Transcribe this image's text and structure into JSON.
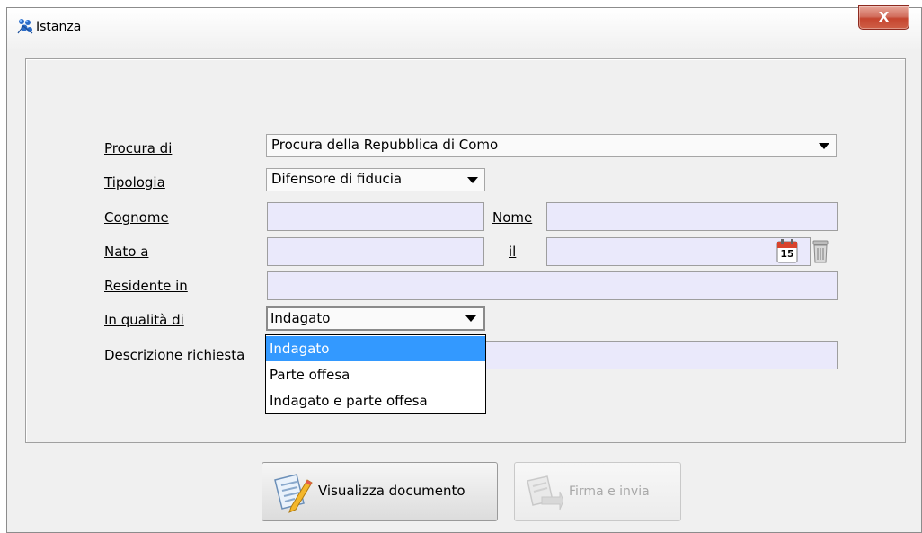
{
  "window": {
    "title": "Istanza",
    "close_symbol": "X"
  },
  "form": {
    "procura": {
      "label": "Procura di",
      "value": "Procura della Repubblica di Como"
    },
    "tipologia": {
      "label": "Tipologia",
      "value": "Difensore di fiducia"
    },
    "cognome": {
      "label": "Cognome",
      "value": ""
    },
    "nome": {
      "label": "Nome",
      "value": ""
    },
    "nato_a": {
      "label": "Nato a",
      "value": ""
    },
    "il": {
      "label": "il",
      "value": "",
      "calendar_day": "15"
    },
    "residente_in": {
      "label": "Residente in ",
      "value": ""
    },
    "in_qualita_di": {
      "label": "In qualità di",
      "value": "Indagato",
      "options": [
        "Indagato",
        "Parte offesa",
        "Indagato e parte offesa"
      ],
      "selected_index": 0
    },
    "descrizione_richiesta": {
      "label": "Descrizione richiesta",
      "value": ""
    }
  },
  "buttons": {
    "visualizza": {
      "label": "Visualizza documento",
      "icon": "document-edit-icon"
    },
    "firma": {
      "label": "Firma e invia",
      "icon": "document-send-icon",
      "enabled": false
    }
  },
  "icons": {
    "calendar": "calendar-icon",
    "trash": "trash-icon",
    "app": "app-icon"
  }
}
